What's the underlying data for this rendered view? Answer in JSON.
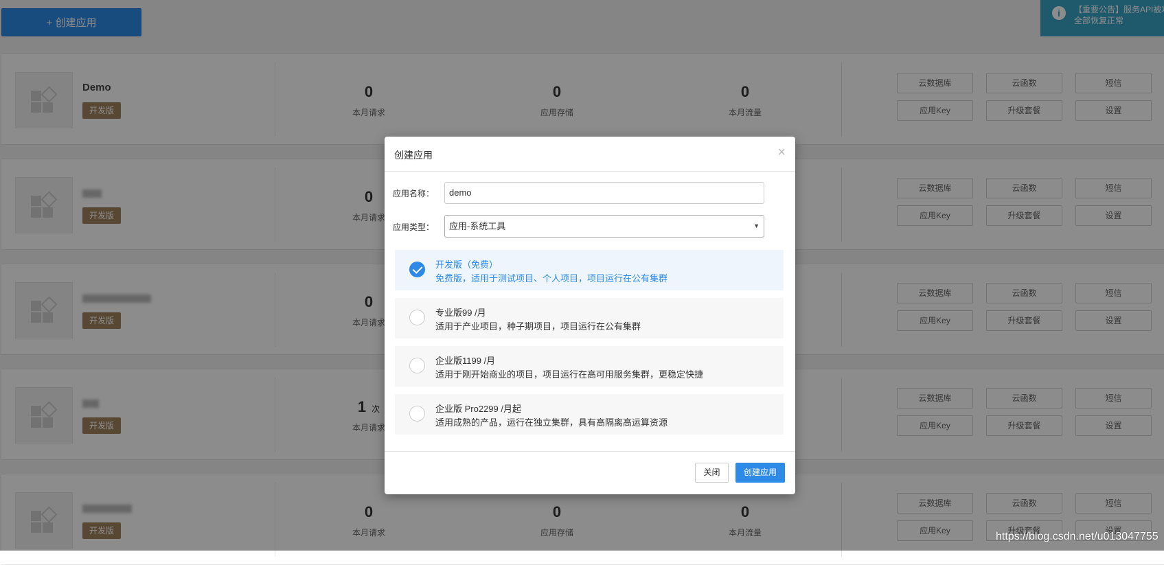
{
  "top_button": {
    "label": "+ 创建应用"
  },
  "notice": {
    "line1": "【重要公告】服务API被攻",
    "line2": "全部恢复正常"
  },
  "stat_labels": {
    "requests": "本月请求",
    "storage": "应用存储",
    "traffic": "本月流量",
    "times_unit": "次"
  },
  "action_buttons": [
    "云数据库",
    "云函数",
    "短信",
    "应用Key",
    "升级套餐",
    "设置"
  ],
  "apps": [
    {
      "name": "Demo",
      "badge": "开发版",
      "requests": "0",
      "storage": "0",
      "traffic": "0"
    },
    {
      "name": "",
      "badge": "开发版",
      "requests": "0",
      "storage": "",
      "traffic": ""
    },
    {
      "name": "",
      "badge": "开发版",
      "requests": "0",
      "storage": "",
      "traffic": ""
    },
    {
      "name": "",
      "badge": "开发版",
      "requests": "1",
      "storage": "",
      "traffic": ""
    },
    {
      "name": "",
      "badge": "开发版",
      "requests": "0",
      "storage": "0",
      "traffic": "0"
    }
  ],
  "modal": {
    "title": "创建应用",
    "close_symbol": "×",
    "name_label": "应用名称：",
    "name_value": "demo",
    "type_label": "应用类型：",
    "type_value": "应用-系统工具",
    "plans": [
      {
        "title": "开发版（免费）",
        "desc": "免费版，适用于测试项目、个人项目，项目运行在公有集群",
        "selected": true
      },
      {
        "title": "专业版99 /月",
        "desc": "适用于产业项目，种子期项目，项目运行在公有集群",
        "selected": false
      },
      {
        "title": "企业版1199 /月",
        "desc": "适用于刚开始商业的项目，项目运行在高可用服务集群，更稳定快捷",
        "selected": false
      },
      {
        "title": "企业版 Pro2299 /月起",
        "desc": "适用成熟的产品，运行在独立集群，具有高隔离高运算资源",
        "selected": false
      }
    ],
    "close_button": "关闭",
    "create_button": "创建应用"
  },
  "watermark": "https://blog.csdn.net/u013047755",
  "colors": {
    "primary": "#2d8ae6",
    "badge": "#a0835d",
    "notice": "#3aa5c5"
  }
}
